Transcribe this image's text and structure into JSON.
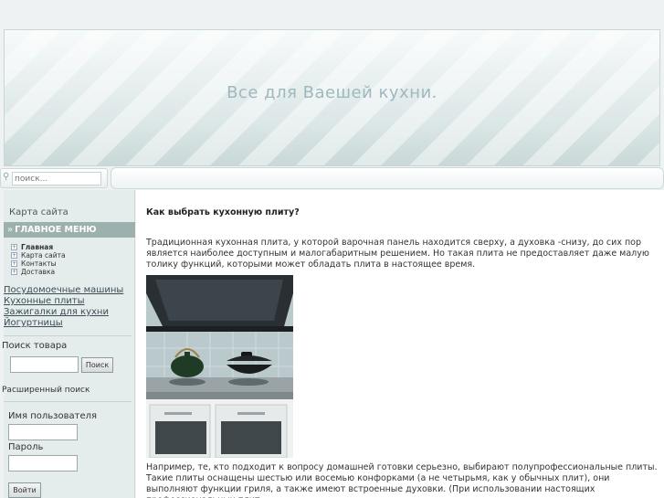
{
  "header": {
    "title": "Все для Ваешей кухни."
  },
  "search": {
    "placeholder": "поиск..."
  },
  "sidebar": {
    "sitemap_link": "Карта сайта",
    "menu_header": "ГЛАВНОЕ МЕНЮ",
    "menu_items": [
      "Главная",
      "Карта сайта",
      "Контакты",
      "Доставка"
    ],
    "categories": [
      "Посудомоечные машины",
      "Кухонные плиты",
      "Зажигалки для кухни",
      "Йогуртницы"
    ],
    "product_search": {
      "heading": "Поиск товара",
      "button": "Поиск"
    },
    "advanced_search": "Расширенный поиск",
    "login": {
      "username_label": "Имя пользователя",
      "password_label": "Пароль",
      "button": "Войти"
    }
  },
  "article": {
    "title": "Как выбрать кухонную плиту?",
    "paragraph1": "Традиционная кухонная плита, у которой варочная панель находится сверху, а духовка -снизу, до сих пор является наиболее доступным и малогабаритным решением. Но такая плита не предоставляет даже малую толику функций, которыми может обладать плита в настоящее время.",
    "paragraph2": "Например, те, кто подходит к вопросу домашней готовки серьезно, выбирают полупрофессиональные плиты. Такие плиты оснащены шестью или восемью конфорками (а не четырьмя, как у обычных плит), они выполняют функции гриля, а также имеют встроенные духовки. (При использовании настоящих профессиональных плит"
  }
}
